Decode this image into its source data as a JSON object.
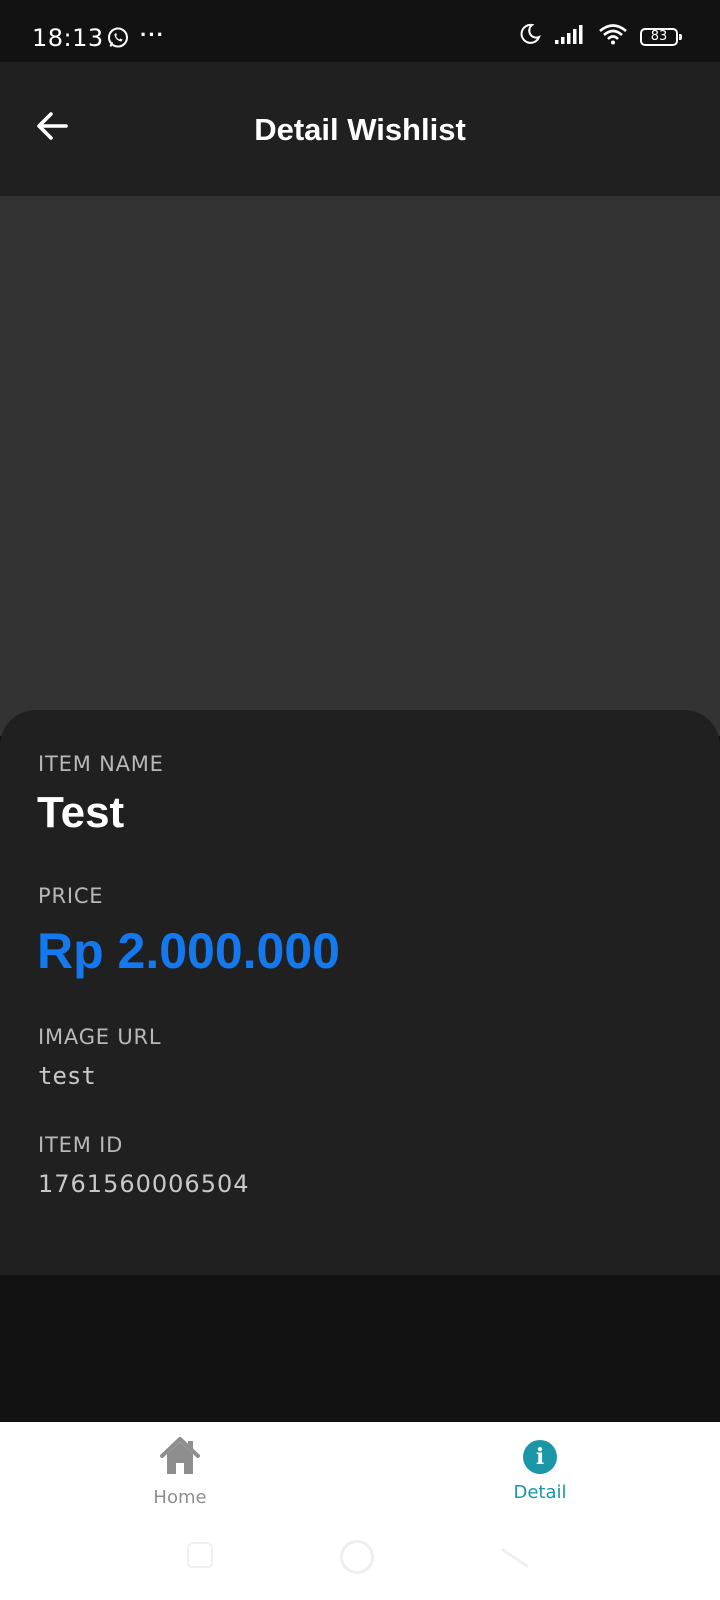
{
  "status_bar": {
    "time": "18:13",
    "more_dots": "···",
    "battery": "83",
    "icons": [
      "whatsapp-icon",
      "moon-icon",
      "signal-icon",
      "wifi-icon",
      "battery-icon"
    ]
  },
  "app_bar": {
    "title": "Detail Wishlist",
    "back_icon": "arrow-left-icon"
  },
  "detail": {
    "item_name_label": "ITEM NAME",
    "item_name": "Test",
    "price_label": "PRICE",
    "price": "Rp 2.000.000",
    "image_url_label": "IMAGE URL",
    "image_url": "test",
    "item_id_label": "ITEM ID",
    "item_id": "1761560006504"
  },
  "bottom_nav": {
    "items": [
      {
        "label": "Home",
        "icon": "home-icon",
        "active": false
      },
      {
        "label": "Detail",
        "icon": "info-icon",
        "active": true
      }
    ]
  },
  "colors": {
    "background": "#121212",
    "app_bar": "#202020",
    "image_placeholder": "#333333",
    "card": "#202020",
    "price": "#1479ee",
    "accent": "#1a96a6",
    "inactive_nav": "#8e8e8e"
  }
}
